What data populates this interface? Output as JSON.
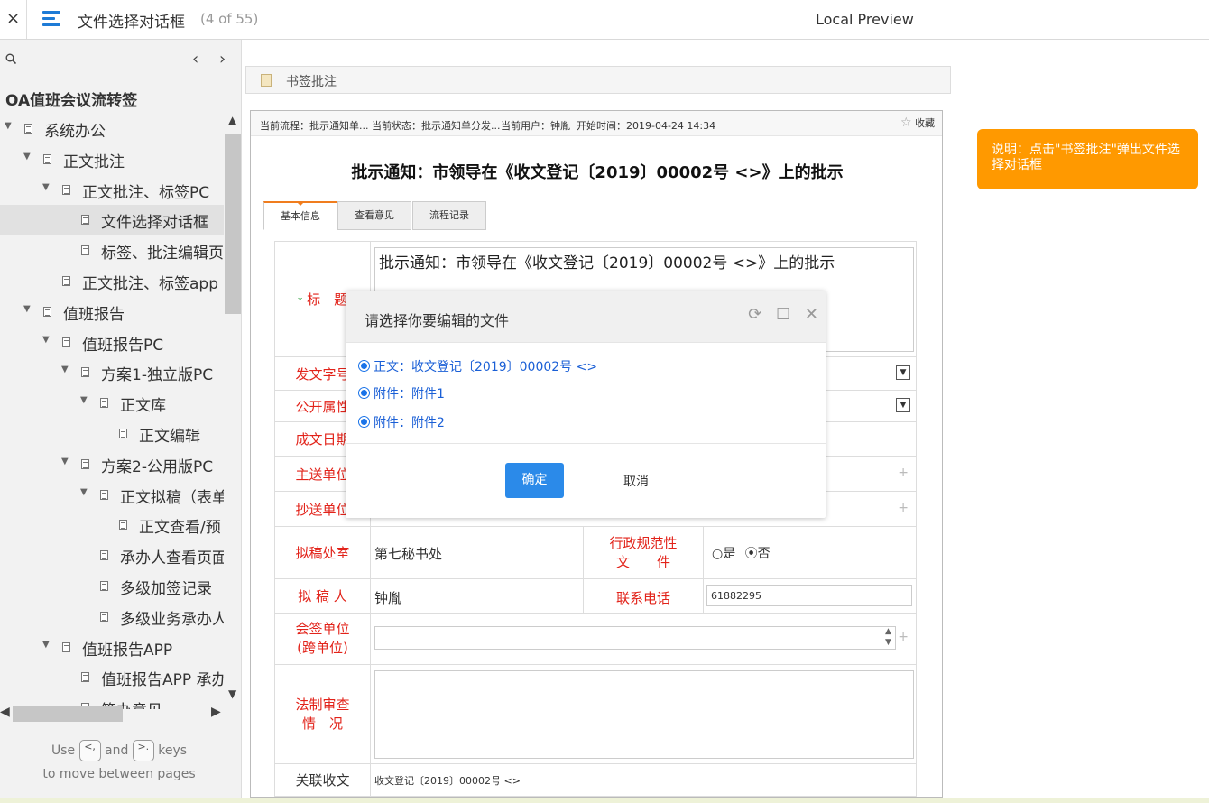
{
  "topbar": {
    "close_label": "×",
    "doc_title": "文件选择对话框",
    "doc_count": "(4 of 55)",
    "preview_label": "Local Preview"
  },
  "sidebar": {
    "nav_prev": "‹",
    "nav_next": "›",
    "project_title": "OA值班会议流转签",
    "tree": [
      {
        "label": "系统办公",
        "level": 0,
        "expanded": true
      },
      {
        "label": "正文批注",
        "level": 1,
        "expanded": true
      },
      {
        "label": "正文批注、标签PC",
        "level": 2,
        "expanded": true
      },
      {
        "label": "文件选择对话框",
        "level": 3,
        "selected": true
      },
      {
        "label": "标签、批注编辑页",
        "level": 3
      },
      {
        "label": "正文批注、标签app",
        "level": 2
      },
      {
        "label": "值班报告",
        "level": 1,
        "expanded": true
      },
      {
        "label": "值班报告PC",
        "level": 2,
        "expanded": true
      },
      {
        "label": "方案1-独立版PC",
        "level": 3,
        "expanded": true
      },
      {
        "label": "正文库",
        "level": 4,
        "expanded": true
      },
      {
        "label": "正文编辑",
        "level": 5
      },
      {
        "label": "方案2-公用版PC",
        "level": 3,
        "expanded": true
      },
      {
        "label": "正文拟稿（表单",
        "level": 4,
        "expanded": true
      },
      {
        "label": "正文查看/预",
        "level": 5
      },
      {
        "label": "承办人查看页面",
        "level": 4
      },
      {
        "label": "多级加签记录",
        "level": 4
      },
      {
        "label": "多级业务承办人",
        "level": 4
      },
      {
        "label": "值班报告APP",
        "level": 2,
        "expanded": true
      },
      {
        "label": "值班报告APP 承办",
        "level": 3
      },
      {
        "label": "签办意见",
        "level": 3
      }
    ],
    "hint_use": "Use",
    "hint_and": "and",
    "hint_keys": "keys",
    "hint_line2": "to move between pages",
    "key_prev": "<,",
    "key_next": ">."
  },
  "page": {
    "header_label": "书签批注",
    "infobar": {
      "flow": "当前流程：批示通知单...",
      "state": "当前状态：批示通知单分发...",
      "user": "当前用户：钟胤",
      "start": "开始时间：2019-04-24 14:34",
      "fav": "收藏"
    },
    "form_title": "批示通知：市领导在《收文登记〔2019〕00002号 <>》上的批示",
    "tabs": [
      "基本信息",
      "查看意见",
      "流程记录"
    ],
    "fields": {
      "title_label": "标　题",
      "title_required": "*",
      "title_value": "批示通知：市领导在《收文登记〔2019〕00002号 <>》上的批示",
      "doc_number_label": "发文字号",
      "public_label": "公开属性",
      "date_label": "成文日期",
      "main_send_label": "主送单位",
      "cc_label": "抄送单位",
      "draft_office_label": "拟稿处室",
      "draft_office_value": "第七秘书处",
      "admin_norm_label_1": "行政规范性",
      "admin_norm_label_2": "文　　件",
      "radio_yes": "是",
      "radio_no": "否",
      "drafter_label": "拟 稿 人",
      "drafter_value": "钟胤",
      "phone_label": "联系电话",
      "phone_value": "61882295",
      "countersign_label_1": "会签单位",
      "countersign_label_2": "(跨单位)",
      "legal_label_1": "法制审查",
      "legal_label_2": "情　况",
      "related_label": "关联收文",
      "related_value": "收文登记〔2019〕00002号 <>"
    }
  },
  "dialog": {
    "title": "请选择你要编辑的文件",
    "options": [
      "正文：收文登记〔2019〕00002号 <>",
      "附件：附件1",
      "附件：附件2"
    ],
    "ok_label": "确定",
    "cancel_label": "取消"
  },
  "note": {
    "text": "说明：点击\"书签批注\"弹出文件选择对话框"
  },
  "colors": {
    "accent_blue": "#1e7bd6",
    "note_orange": "#ff9900",
    "label_red": "#e2231a",
    "ok_button": "#2b8ae9"
  }
}
